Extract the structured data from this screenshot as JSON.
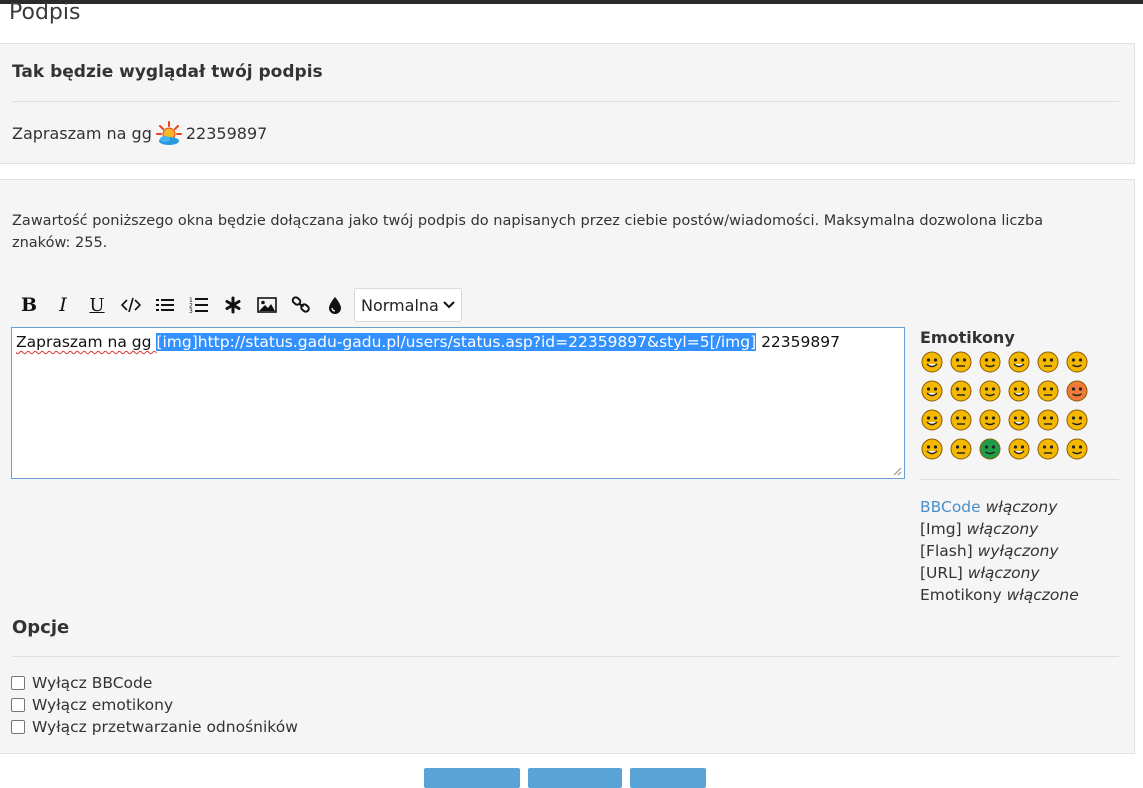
{
  "page": {
    "title": "Podpis"
  },
  "preview": {
    "heading": "Tak będzie wyglądał twój podpis",
    "text_before": "Zapraszam na gg",
    "status_icon": "gg-status-sun-icon",
    "number": "22359897"
  },
  "editor": {
    "info": "Zawartość poniższego okna będzie dołączana jako twój podpis do napisanych przez ciebie postów/wiadomości. Maksymalna dozwolona liczba znaków: 255.",
    "toolbar": {
      "buttons": [
        {
          "name": "bold",
          "label": "B"
        },
        {
          "name": "italic",
          "label": "I"
        },
        {
          "name": "underline",
          "label": "U"
        },
        {
          "name": "code",
          "icon": "code-icon"
        },
        {
          "name": "list",
          "icon": "bullet-list-icon"
        },
        {
          "name": "ordered-list",
          "icon": "numbered-list-icon"
        },
        {
          "name": "star",
          "icon": "asterisk-icon"
        },
        {
          "name": "image",
          "icon": "image-icon"
        },
        {
          "name": "link",
          "icon": "link-icon"
        },
        {
          "name": "color",
          "icon": "drop-icon"
        }
      ],
      "font_size": "Normalna"
    },
    "textarea": {
      "before": "Zapraszam na gg ",
      "selected": "[img]http://status.gadu-gadu.pl/users/status.asp?id=22359897&styl=5[/img]",
      "after": " 22359897"
    }
  },
  "emoticons": {
    "title": "Emotikony",
    "count": 24
  },
  "bbcode_status": {
    "bbcode_label": "BBCode",
    "bbcode_state": "włączony",
    "img_label": "[Img]",
    "img_state": "włączony",
    "flash_label": "[Flash]",
    "flash_state": "wyłączony",
    "url_label": "[URL]",
    "url_state": "włączony",
    "emo_label": "Emotikony",
    "emo_state": "włączone"
  },
  "options": {
    "title": "Opcje",
    "items": [
      {
        "label": "Wyłącz BBCode",
        "checked": false
      },
      {
        "label": "Wyłącz emotikony",
        "checked": false
      },
      {
        "label": "Wyłącz przetwarzanie odnośników",
        "checked": false
      }
    ]
  },
  "colors": {
    "accent": "#5aa3d6",
    "link": "#4a90c8",
    "selection": "#3390ff"
  }
}
